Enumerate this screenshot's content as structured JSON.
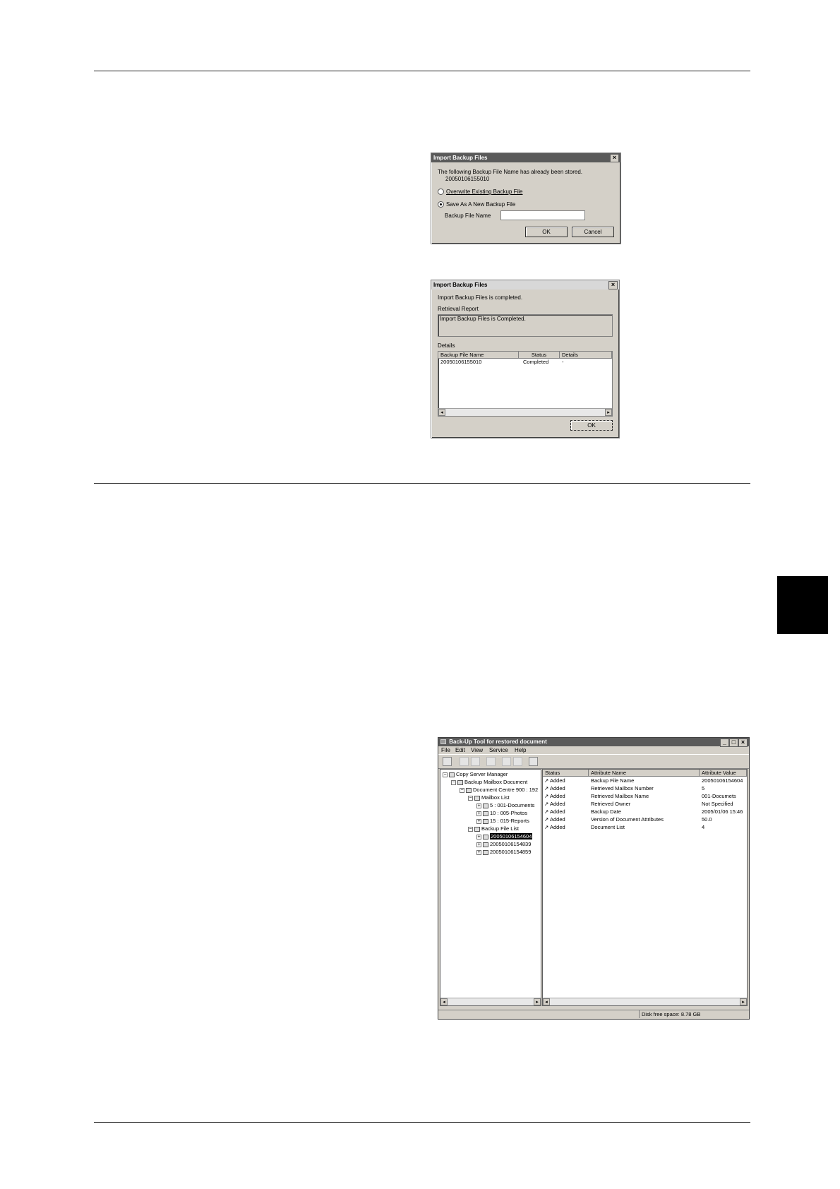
{
  "dialog1": {
    "title": "Import Backup Files",
    "message": "The following Backup File Name has already been stored.",
    "file_name": "20050106155010",
    "option_overwrite": "Overwrite Existing Backup File",
    "option_save_new": "Save As A New Backup File",
    "field_label": "Backup File Name",
    "field_value": "",
    "ok": "OK",
    "cancel": "Cancel",
    "close": "×"
  },
  "dialog2": {
    "title": "Import Backup Files",
    "message": "Import Backup Files is completed.",
    "report_label": "Retrieval Report",
    "report_text": "Import Backup Files is Completed.",
    "details_label": "Details",
    "columns": [
      "Backup File Name",
      "Status",
      "Details"
    ],
    "rows": [
      [
        "20050106155010",
        "Completed",
        "-"
      ]
    ],
    "ok": "OK",
    "close": "×"
  },
  "app": {
    "title": "Back-Up Tool for restored document",
    "window_buttons": [
      "_",
      "□",
      "×"
    ],
    "menu": [
      "File",
      "Edit",
      "View",
      "Service",
      "Help"
    ],
    "tree": {
      "root": "Copy Server Manager",
      "backup_mailbox": "Backup Mailbox Document",
      "device": "Document Centre 900 : 192",
      "mailbox_list": "Mailbox List",
      "mailboxes": [
        "5 : 001-Documents",
        "10 : 005-Photos",
        "15 : 015-Reports"
      ],
      "backup_file_list": "Backup File List",
      "backup_files": [
        "20050106154604",
        "20050106154839",
        "20050106154859"
      ]
    },
    "columns": [
      "Status",
      "Attribute Name",
      "Attribute Value"
    ],
    "rows": [
      [
        "Added",
        "Backup File Name",
        "20050106154604"
      ],
      [
        "Added",
        "Retrieved Mailbox Number",
        "5"
      ],
      [
        "Added",
        "Retrieved Mailbox Name",
        "001-Documets"
      ],
      [
        "Added",
        "Retrieved Owner",
        "Not Specified"
      ],
      [
        "Added",
        "Backup Date",
        "2005/01/06 15:46"
      ],
      [
        "Added",
        "Version of Document Attributes",
        "50.0"
      ],
      [
        "Added",
        "Document List",
        "4"
      ]
    ],
    "status_text": "Disk free space: 8.78 GB"
  }
}
